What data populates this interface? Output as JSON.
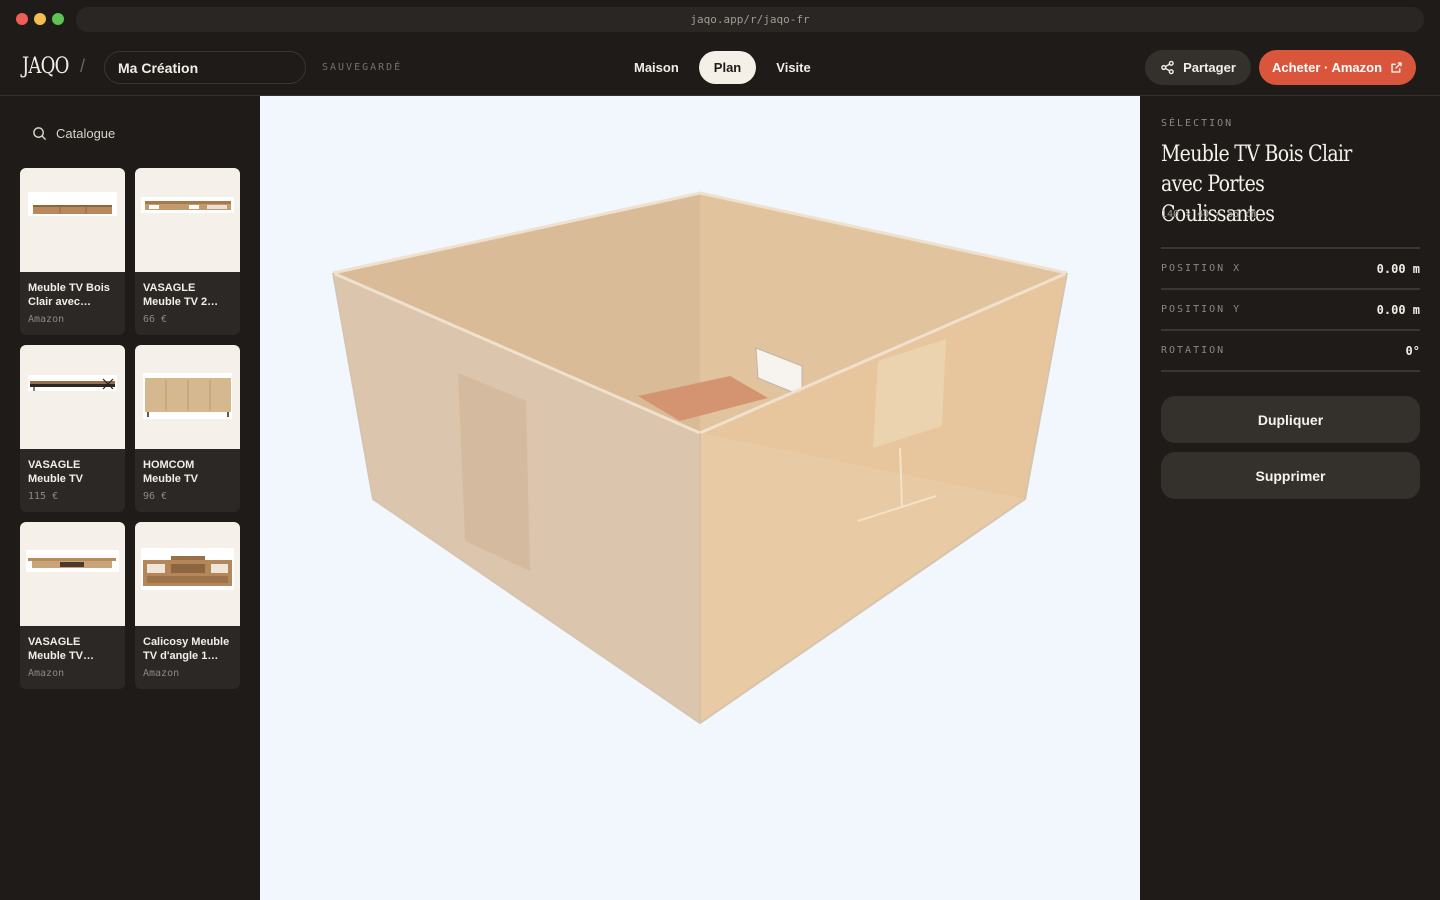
{
  "browser": {
    "url": "jaqo.app/r/jaqo-fr"
  },
  "header": {
    "logo": "JAQO",
    "separator": "/",
    "project_name": "Ma Création",
    "save_status": "SAUVEGARDÉ",
    "modes": [
      {
        "label": "Maison",
        "active": false
      },
      {
        "label": "Plan",
        "active": true
      },
      {
        "label": "Visite",
        "active": false
      }
    ],
    "share_label": "Partager",
    "buy_label": "Acheter · Amazon"
  },
  "sidebar": {
    "catalog_label": "Catalogue",
    "items": [
      {
        "title": "Meuble TV Bois Clair avec…",
        "meta": "Amazon"
      },
      {
        "title": "VASAGLE Meuble TV 2…",
        "meta": "66 €"
      },
      {
        "title": "VASAGLE Meuble TV pou…",
        "meta": "115 €"
      },
      {
        "title": "HOMCOM Meuble TV Ban…",
        "meta": "96 €"
      },
      {
        "title": "VASAGLE Meuble TV…",
        "meta": "Amazon"
      },
      {
        "title": "Calicosy Meuble TV d'angle 1…",
        "meta": "Amazon"
      }
    ]
  },
  "selection": {
    "label": "SÉLECTION",
    "title": "Meuble TV Bois Clair avec Portes Coulissantes",
    "dimensions": "140 × 40 × 55 cm",
    "properties": [
      {
        "key": "POSITION X",
        "value": "0.00 m"
      },
      {
        "key": "POSITION Y",
        "value": "0.00 m"
      },
      {
        "key": "ROTATION",
        "value": "0°"
      }
    ],
    "duplicate_label": "Dupliquer",
    "delete_label": "Supprimer"
  },
  "colors": {
    "accent": "#d9553c",
    "background": "#1e1b18",
    "viewport": "#f1f7fd"
  }
}
